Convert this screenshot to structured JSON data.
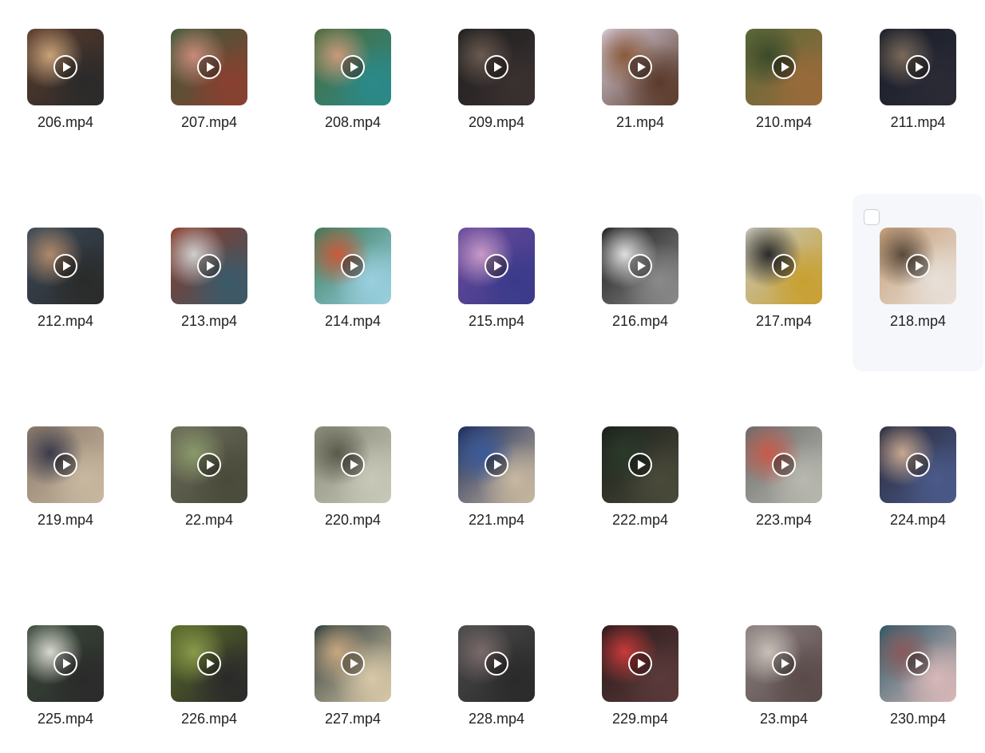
{
  "files": [
    {
      "name": "206.mp4",
      "colors": [
        "#5a3b2c",
        "#c8a27a",
        "#2a2a2a"
      ]
    },
    {
      "name": "207.mp4",
      "colors": [
        "#3a5a3a",
        "#c98a7a",
        "#8a4030"
      ]
    },
    {
      "name": "208.mp4",
      "colors": [
        "#4b6a3a",
        "#c99a7a",
        "#2a8a8a"
      ]
    },
    {
      "name": "209.mp4",
      "colors": [
        "#1e1e1e",
        "#6a5a50",
        "#3a3030"
      ]
    },
    {
      "name": "21.mp4",
      "colors": [
        "#d8cfe0",
        "#8a5a3a",
        "#5a3a2a"
      ]
    },
    {
      "name": "210.mp4",
      "colors": [
        "#5a6a3a",
        "#3a4a2a",
        "#9a6a3a"
      ]
    },
    {
      "name": "211.mp4",
      "colors": [
        "#1a1f2a",
        "#7a6a5a",
        "#2a2a35"
      ]
    },
    {
      "name": "212.mp4",
      "colors": [
        "#3a4a5a",
        "#b08a6a",
        "#2a2a2a"
      ]
    },
    {
      "name": "213.mp4",
      "colors": [
        "#8a3a2a",
        "#cfcfcf",
        "#3a5a6a"
      ]
    },
    {
      "name": "214.mp4",
      "colors": [
        "#3a7a5a",
        "#c85a3a",
        "#9ad0e0"
      ]
    },
    {
      "name": "215.mp4",
      "colors": [
        "#6a4a9a",
        "#c89ac8",
        "#3a3a8a"
      ]
    },
    {
      "name": "216.mp4",
      "colors": [
        "#1a1a1a",
        "#e0e0e0",
        "#8a8a8a"
      ]
    },
    {
      "name": "217.mp4",
      "colors": [
        "#c8c8c0",
        "#2a2a2a",
        "#c8a030"
      ]
    },
    {
      "name": "218.mp4",
      "colors": [
        "#c8a07a",
        "#5a4a3a",
        "#e8e0d8"
      ]
    },
    {
      "name": "219.mp4",
      "colors": [
        "#8a7a6a",
        "#3a3a4a",
        "#c8b8a0"
      ]
    },
    {
      "name": "22.mp4",
      "colors": [
        "#6a6a5a",
        "#8a9a6a",
        "#4a4a3a"
      ]
    },
    {
      "name": "220.mp4",
      "colors": [
        "#8a8a7a",
        "#5a5a4a",
        "#c8c8b8"
      ]
    },
    {
      "name": "221.mp4",
      "colors": [
        "#1a2a5a",
        "#3a5a9a",
        "#c8b8a0"
      ]
    },
    {
      "name": "222.mp4",
      "colors": [
        "#1a1f1a",
        "#2a3a2a",
        "#4a4a3a"
      ]
    },
    {
      "name": "223.mp4",
      "colors": [
        "#6a6a6a",
        "#c85a4a",
        "#b8b8b0"
      ]
    },
    {
      "name": "224.mp4",
      "colors": [
        "#2a2a3a",
        "#c8a890",
        "#4a5a8a"
      ]
    },
    {
      "name": "225.mp4",
      "colors": [
        "#3a4a3a",
        "#d8d8d0",
        "#2a2a2a"
      ]
    },
    {
      "name": "226.mp4",
      "colors": [
        "#5a6a2a",
        "#8a9a4a",
        "#2a2a2a"
      ]
    },
    {
      "name": "227.mp4",
      "colors": [
        "#2a3a3a",
        "#c8a880",
        "#d8c8a8"
      ]
    },
    {
      "name": "228.mp4",
      "colors": [
        "#4a4a4a",
        "#7a6a6a",
        "#2a2a2a"
      ]
    },
    {
      "name": "229.mp4",
      "colors": [
        "#2a1a1a",
        "#c83a3a",
        "#5a3a3a"
      ]
    },
    {
      "name": "23.mp4",
      "colors": [
        "#8a8080",
        "#c8c0b8",
        "#5a4a4a"
      ]
    },
    {
      "name": "230.mp4",
      "colors": [
        "#2a5a6a",
        "#8a5a5a",
        "#d8b8b8"
      ]
    }
  ],
  "selection": {
    "hovered_index": 13
  }
}
